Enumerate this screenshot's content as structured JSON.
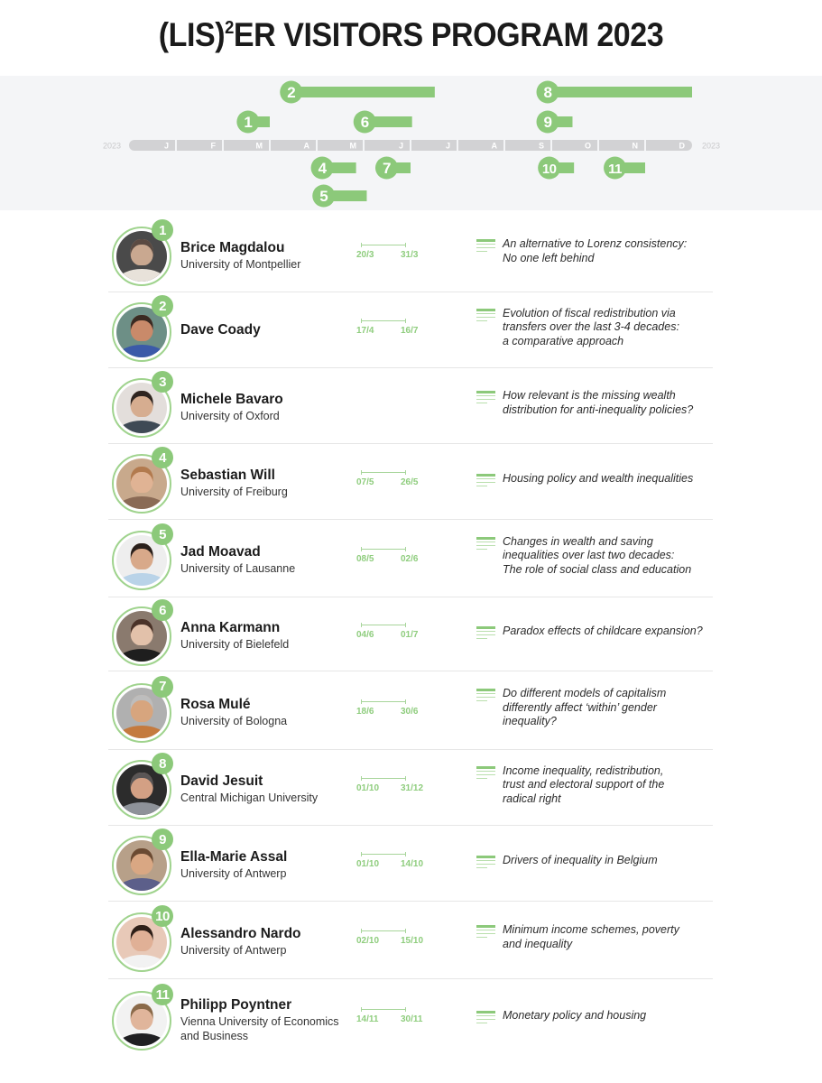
{
  "title": {
    "prefix": "(LIS)",
    "superscript": "2",
    "suffix": "ER VISITORS PROGRAM 2023"
  },
  "colors": {
    "accent_green": "#8cc97a",
    "axis_grey": "#d2d2d4",
    "timeline_background": "#f4f5f7",
    "date_text": "#8fcd7e"
  },
  "chart_data": {
    "type": "timeline",
    "title": "(LIS)²ER Visitors Program 2023",
    "year": 2023,
    "axis_label_left": "2023",
    "axis_label_right": "2023",
    "month_ticks": [
      "J",
      "F",
      "M",
      "A",
      "M",
      "J",
      "J",
      "A",
      "S",
      "O",
      "N",
      "D"
    ],
    "x_range": [
      "01/01",
      "31/12"
    ],
    "grid": false,
    "series": [
      {
        "id": "1",
        "name": "Brice Magdalou",
        "start": "20/3",
        "end": "31/3",
        "lane": "above-1"
      },
      {
        "id": "2",
        "name": "Dave Coady",
        "start": "17/4",
        "end": "16/7",
        "lane": "above-2"
      },
      {
        "id": "4",
        "name": "Sebastian Will",
        "start": "07/5",
        "end": "26/5",
        "lane": "below-1"
      },
      {
        "id": "5",
        "name": "Jad Moavad",
        "start": "08/5",
        "end": "02/6",
        "lane": "below-2"
      },
      {
        "id": "6",
        "name": "Anna Karmann",
        "start": "04/6",
        "end": "01/7",
        "lane": "above-1"
      },
      {
        "id": "7",
        "name": "Rosa Mulé",
        "start": "18/6",
        "end": "30/6",
        "lane": "below-1"
      },
      {
        "id": "8",
        "name": "David Jesuit",
        "start": "01/10",
        "end": "31/12",
        "lane": "above-2"
      },
      {
        "id": "9",
        "name": "Ella-Marie Assal",
        "start": "01/10",
        "end": "14/10",
        "lane": "above-1"
      },
      {
        "id": "10",
        "name": "Alessandro Nardo",
        "start": "02/10",
        "end": "15/10",
        "lane": "below-1"
      },
      {
        "id": "11",
        "name": "Philipp Poyntner",
        "start": "14/11",
        "end": "30/11",
        "lane": "below-1"
      }
    ]
  },
  "visitors": [
    {
      "number": "1",
      "name": "Brice Magdalou",
      "affiliation": "University of Montpellier",
      "start": "20/3",
      "end": "31/3",
      "topic": "An alternative to Lorenz consistency:\nNo one left behind",
      "skin": "#c9a890",
      "hair": "#5a4a42",
      "shirt": "#e8e2da",
      "bg": "#4a4a4a"
    },
    {
      "number": "2",
      "name": "Dave Coady",
      "affiliation": "",
      "start": "17/4",
      "end": "16/7",
      "topic": "Evolution of fiscal redistribution via\ntransfers over the last 3-4 decades:\na comparative approach",
      "skin": "#c98a6a",
      "hair": "#3a2a22",
      "shirt": "#3b5aa8",
      "bg": "#6d8f86"
    },
    {
      "number": "3",
      "name": "Michele Bavaro",
      "affiliation": "University of Oxford",
      "start": "",
      "end": "",
      "topic": "How relevant is the missing wealth\ndistribution for anti-inequality policies?",
      "skin": "#d6ad90",
      "hair": "#2e2420",
      "shirt": "#3f4a55",
      "bg": "#e3dedb"
    },
    {
      "number": "4",
      "name": "Sebastian Will",
      "affiliation": "University of Freiburg",
      "start": "07/5",
      "end": "26/5",
      "topic": "Housing policy and wealth inequalities",
      "skin": "#e0b394",
      "hair": "#b27a4e",
      "shirt": "#8a6a55",
      "bg": "#c8a98c"
    },
    {
      "number": "5",
      "name": "Jad Moavad",
      "affiliation": "University of Lausanne",
      "start": "08/5",
      "end": "02/6",
      "topic": "Changes in wealth and saving\ninequalities over last two decades:\nThe role of social class and education",
      "skin": "#d8a98a",
      "hair": "#2a201c",
      "shirt": "#b9d3e8",
      "bg": "#eeeeee"
    },
    {
      "number": "6",
      "name": "Anna Karmann",
      "affiliation": "University of Bielefeld",
      "start": "04/6",
      "end": "01/7",
      "topic": "Paradox effects of childcare expansion?",
      "skin": "#e2c1aa",
      "hair": "#4a3228",
      "shirt": "#1e1e1e",
      "bg": "#8a7a6e"
    },
    {
      "number": "7",
      "name": "Rosa Mulé",
      "affiliation": "University of Bologna",
      "start": "18/6",
      "end": "30/6",
      "topic": "Do different models of capitalism\ndifferently affect ‘within’ gender\ninequality?",
      "skin": "#d7a57e",
      "hair": "#bdbdbd",
      "shirt": "#c47a3e",
      "bg": "#b0b0b0"
    },
    {
      "number": "8",
      "name": "David Jesuit",
      "affiliation": "Central Michigan University",
      "start": "01/10",
      "end": "31/12",
      "topic": "Income inequality, redistribution,\ntrust and electoral support of the\nradical right",
      "skin": "#d3a084",
      "hair": "#5a5656",
      "shirt": "#8e9299",
      "bg": "#2c2c2c"
    },
    {
      "number": "9",
      "name": "Ella-Marie Assal",
      "affiliation": "University of Antwerp",
      "start": "01/10",
      "end": "14/10",
      "topic": "Drivers of inequality in Belgium",
      "skin": "#d9a783",
      "hair": "#6a4a32",
      "shirt": "#5c5f8a",
      "bg": "#b7a089"
    },
    {
      "number": "10",
      "name": "Alessandro Nardo",
      "affiliation": "University of Antwerp",
      "start": "02/10",
      "end": "15/10",
      "topic": "Minimum income schemes, poverty\nand inequality",
      "skin": "#e0b096",
      "hair": "#2e1f18",
      "shirt": "#f2f2f2",
      "bg": "#e8c9b8"
    },
    {
      "number": "11",
      "name": "Philipp Poyntner",
      "affiliation": "Vienna University of Economics\nand Business",
      "start": "14/11",
      "end": "30/11",
      "topic": "Monetary policy and housing",
      "skin": "#e0b59b",
      "hair": "#8a6a4a",
      "shirt": "#1f1f22",
      "bg": "#f2f2f2"
    }
  ]
}
